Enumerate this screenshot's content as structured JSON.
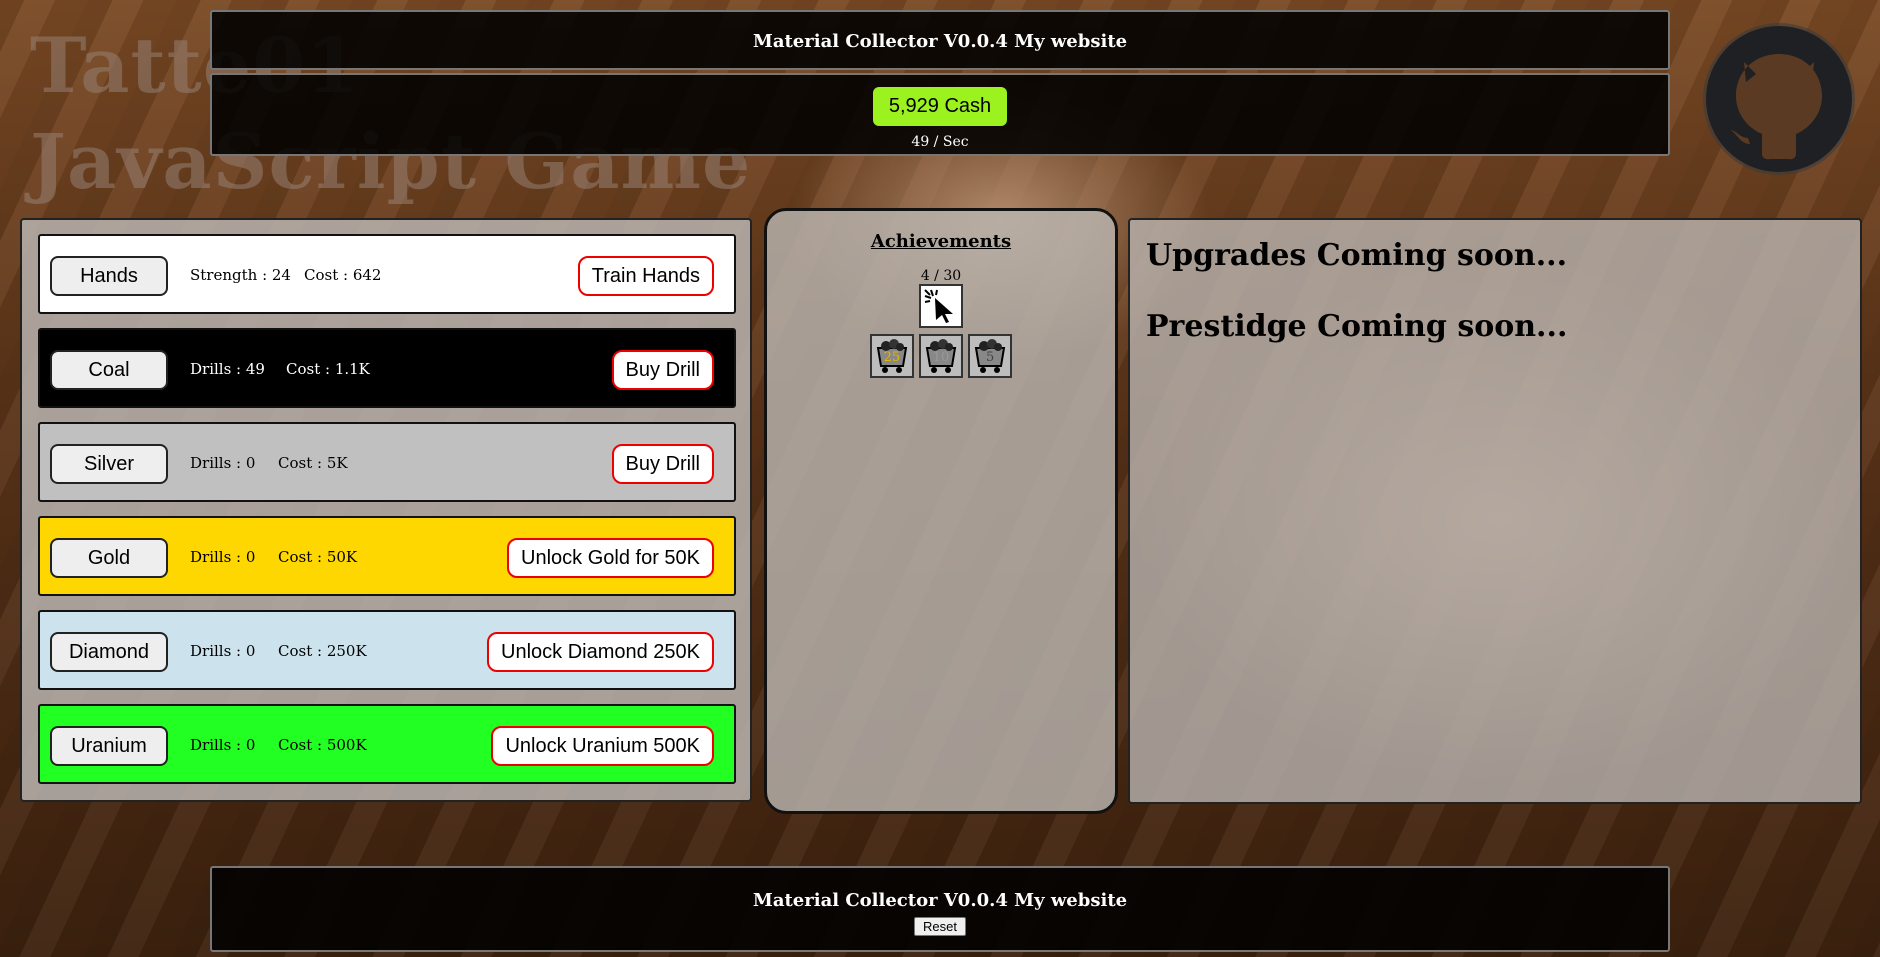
{
  "brand": {
    "line1": "Tatte01",
    "line2": "JavaScript Game"
  },
  "header": {
    "title": "Material Collector V0.0.4 My website"
  },
  "stats": {
    "cash": "5,929 Cash",
    "rate": "49 / Sec"
  },
  "materials": [
    {
      "name": "Hands",
      "stat_label": "Strength : 24",
      "cost_label": "Cost :  642",
      "action": "Train Hands",
      "color": "#ffffff",
      "text_color": "#000000"
    },
    {
      "name": "Coal",
      "stat_label": "Drills : 49",
      "cost_label": "Cost :  1.1K",
      "action": "Buy Drill",
      "color": "#000000",
      "text_color": "#ffffff"
    },
    {
      "name": "Silver",
      "stat_label": "Drills : 0",
      "cost_label": "Cost :  5K",
      "action": "Buy Drill",
      "color": "#c0c0c0",
      "text_color": "#000000"
    },
    {
      "name": "Gold",
      "stat_label": "Drills : 0",
      "cost_label": "Cost :  50K",
      "action": "Unlock Gold for 50K",
      "color": "#ffd700",
      "text_color": "#000000"
    },
    {
      "name": "Diamond",
      "stat_label": "Drills : 0",
      "cost_label": "Cost :  250K",
      "action": "Unlock Diamond 250K",
      "color": "#cce3ee",
      "text_color": "#000000"
    },
    {
      "name": "Uranium",
      "stat_label": "Drills : 0",
      "cost_label": "Cost :  500K",
      "action": "Unlock Uranium 500K",
      "color": "#22ff22",
      "text_color": "#000000"
    }
  ],
  "achievements": {
    "title": "Achievements",
    "count": "4 / 30",
    "items": [
      {
        "icon": "cursor-click-icon"
      },
      {
        "icon": "mine-cart-icon",
        "label": "25",
        "label_color": "#e8b400"
      },
      {
        "icon": "mine-cart-icon",
        "label": "10",
        "label_color": "#999999"
      },
      {
        "icon": "mine-cart-icon",
        "label": "5",
        "label_color": "#444444"
      }
    ]
  },
  "upgrades": {
    "upgrades_text": "Upgrades Coming soon...",
    "prestige_text": "Prestidge Coming soon..."
  },
  "footer": {
    "title": "Material Collector V0.0.4 My website",
    "reset_label": "Reset"
  }
}
